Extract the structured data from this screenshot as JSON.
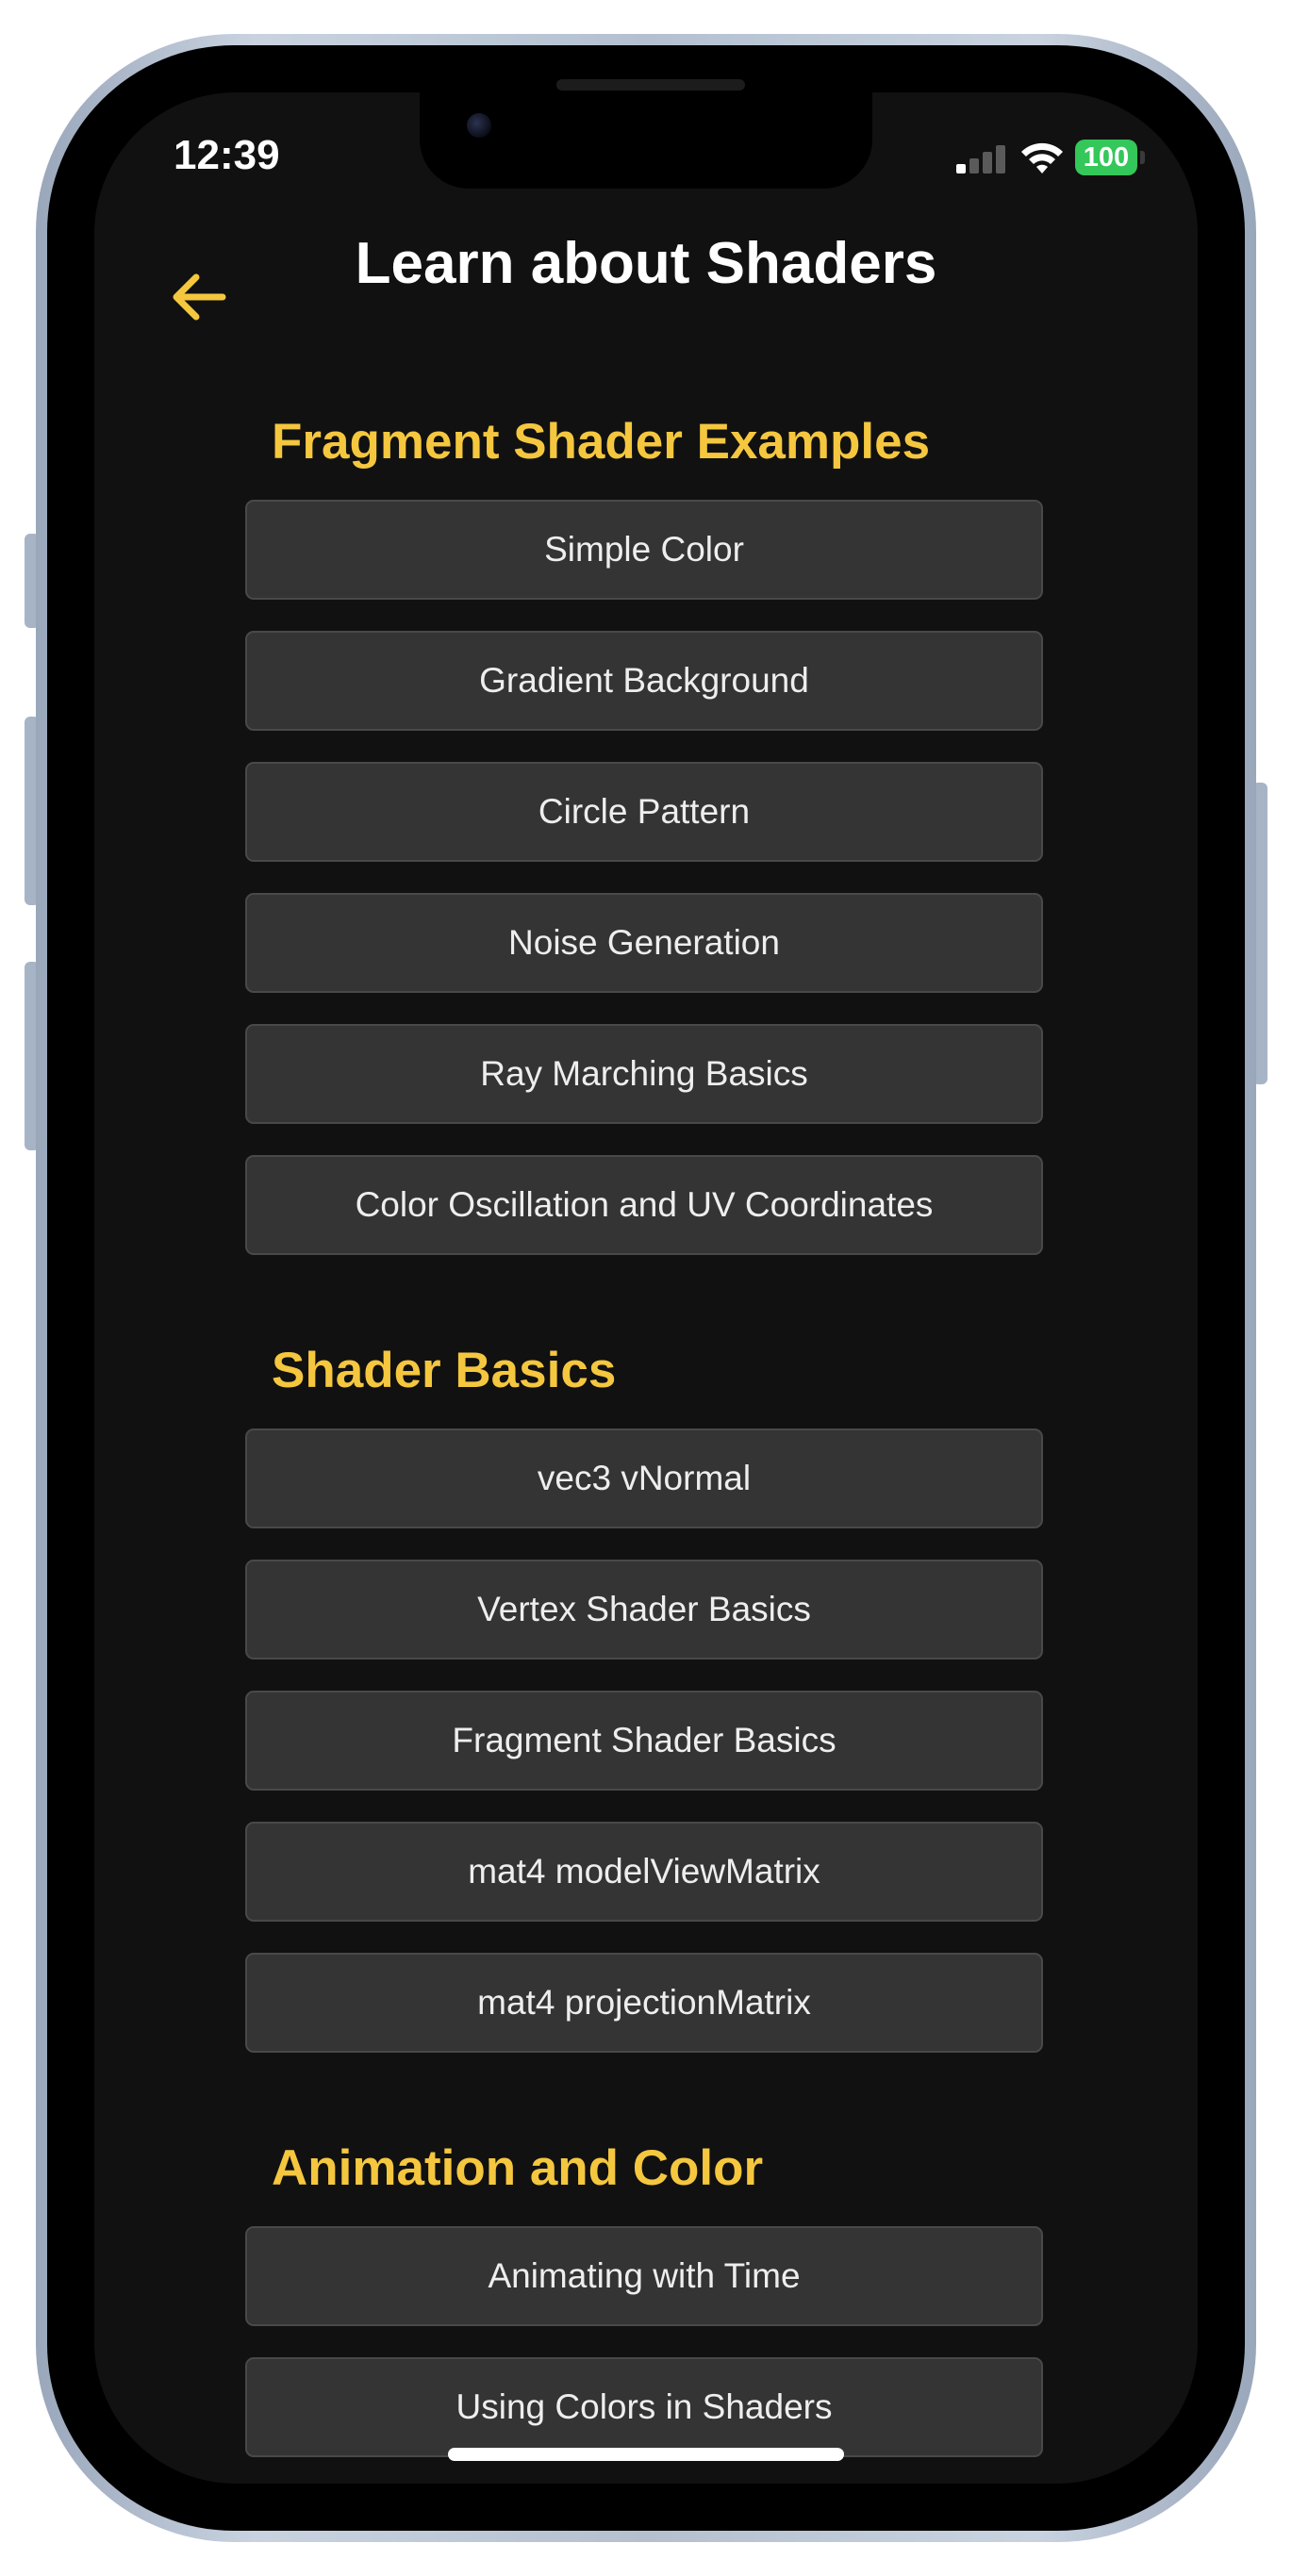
{
  "status_bar": {
    "time": "12:39",
    "battery": "100"
  },
  "header": {
    "title": "Learn about Shaders",
    "back_icon": "arrow-left-icon"
  },
  "colors": {
    "accent": "#f5c73f",
    "background": "#111111",
    "item_bg": "#343434",
    "battery": "#34c759"
  },
  "sections": [
    {
      "title": "Fragment Shader Examples",
      "items": [
        "Simple Color",
        "Gradient Background",
        "Circle Pattern",
        "Noise Generation",
        "Ray Marching Basics",
        "Color Oscillation and UV Coordinates"
      ]
    },
    {
      "title": "Shader Basics",
      "items": [
        "vec3 vNormal",
        "Vertex Shader Basics",
        "Fragment Shader Basics",
        "mat4 modelViewMatrix",
        "mat4 projectionMatrix"
      ]
    },
    {
      "title": "Animation and Color",
      "items": [
        "Animating with Time",
        "Using Colors in Shaders"
      ]
    }
  ]
}
